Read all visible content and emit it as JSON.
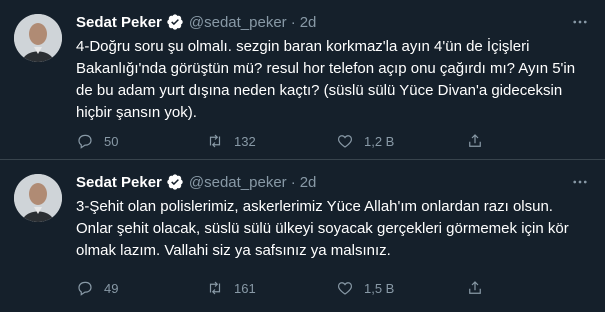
{
  "tweets": [
    {
      "name": "Sedat Peker",
      "handle": "@sedat_peker",
      "time": "2d",
      "text": "4-Doğru soru şu olmalı. sezgin baran korkmaz'la ayın 4'ün de İçişleri Bakanlığı'nda görüştün mü? resul hor telefon açıp onu çağırdı mı? Ayın 5'in de bu adam yurt dışına neden kaçtı? (süslü sülü Yüce Divan'a gideceksin hiçbir şansın yok).",
      "replies": "50",
      "retweets": "132",
      "likes": "1,2 B"
    },
    {
      "name": "Sedat Peker",
      "handle": "@sedat_peker",
      "time": "2d",
      "text": "3-Şehit olan polislerimiz, askerlerimiz Yüce Allah'ım onlardan razı olsun. Onlar şehit olacak, süslü sülü ülkeyi soyacak gerçekleri görmemek için kör olmak lazım. Vallahi siz ya safsınız ya malsınız.",
      "replies": "49",
      "retweets": "161",
      "likes": "1,5 B"
    }
  ],
  "separator": "·",
  "colors": {
    "background": "#15202b",
    "muted": "#8899a6",
    "verified": "#ffffff",
    "divider": "#38444d"
  },
  "icons": [
    "verified-badge-icon",
    "more-icon",
    "reply-icon",
    "retweet-icon",
    "like-icon",
    "share-icon"
  ]
}
